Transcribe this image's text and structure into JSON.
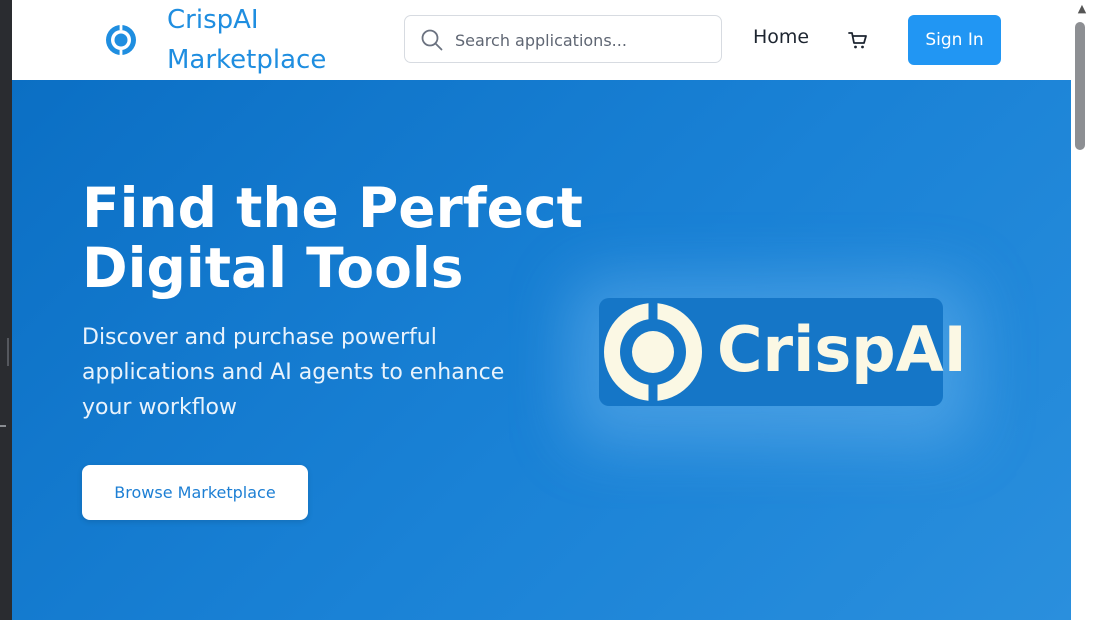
{
  "header": {
    "brand_line1": "CrispAI",
    "brand_line2": "Marketplace",
    "search_placeholder": "Search applications...",
    "nav_home": "Home",
    "sign_in": "Sign In",
    "icons": [
      "logo-mark",
      "search-icon",
      "cart-icon"
    ]
  },
  "hero": {
    "title": "Find the Perfect Digital Tools",
    "subtitle": "Discover and purchase powerful applications and AI agents to enhance your workflow",
    "cta": "Browse Marketplace",
    "logo_wordmark": "CrispAI"
  },
  "colors": {
    "brand_blue": "#1f8ee0",
    "hero_gradient_start": "#0b6fc4",
    "hero_gradient_end": "#2a8fdd",
    "button_blue": "#2196f3",
    "logo_cream": "#fbf8e4"
  }
}
